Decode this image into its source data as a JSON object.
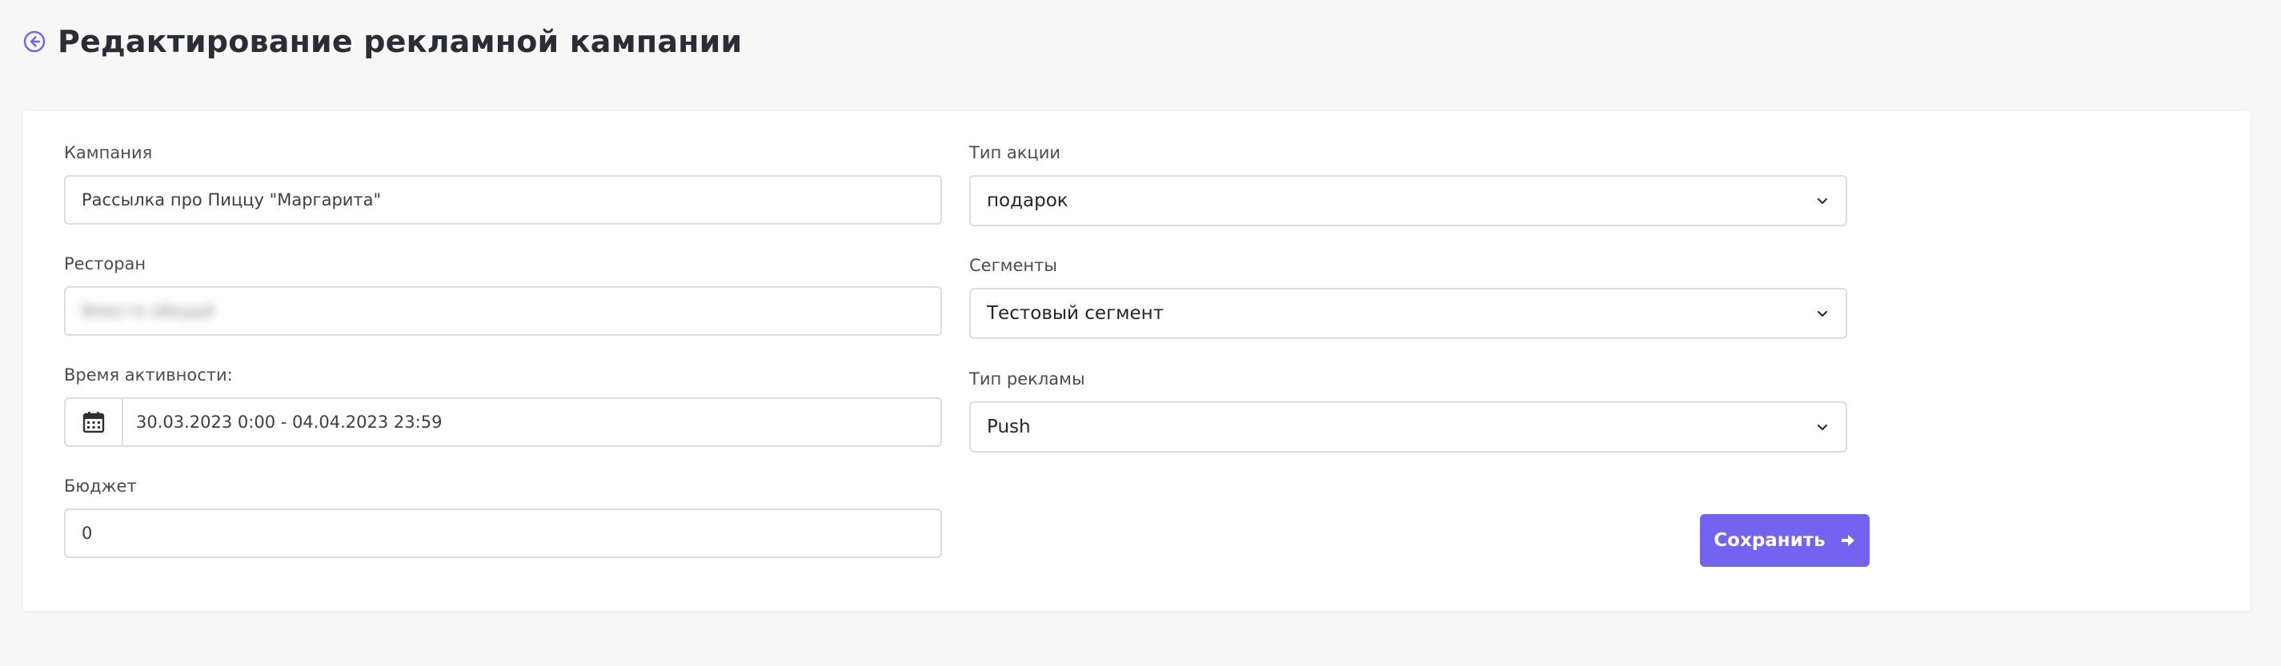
{
  "header": {
    "title": "Редактирование рекламной кампании"
  },
  "form": {
    "campaign": {
      "label": "Кампания",
      "value": "Рассылка про Пиццу \"Маргарита\""
    },
    "restaurant": {
      "label": "Ресторан",
      "value": "Вместе обедай"
    },
    "activity_time": {
      "label": "Время активности:",
      "value": "30.03.2023 0:00 - 04.04.2023 23:59"
    },
    "budget": {
      "label": "Бюджет",
      "value": "0"
    },
    "action_type": {
      "label": "Тип акции",
      "value": "подарок"
    },
    "segments": {
      "label": "Сегменты",
      "value": "Тестовый сегмент"
    },
    "ad_type": {
      "label": "Тип рекламы",
      "value": "Push"
    },
    "save_label": "Сохранить"
  },
  "colors": {
    "accent": "#7363f0",
    "background": "#f7f7f7",
    "card": "#ffffff",
    "border": "#dcdce2"
  },
  "icons": {
    "back": "arrow-left-circle-icon",
    "calendar": "calendar-icon",
    "chevron": "chevron-down-icon",
    "save": "arrow-right-icon"
  }
}
